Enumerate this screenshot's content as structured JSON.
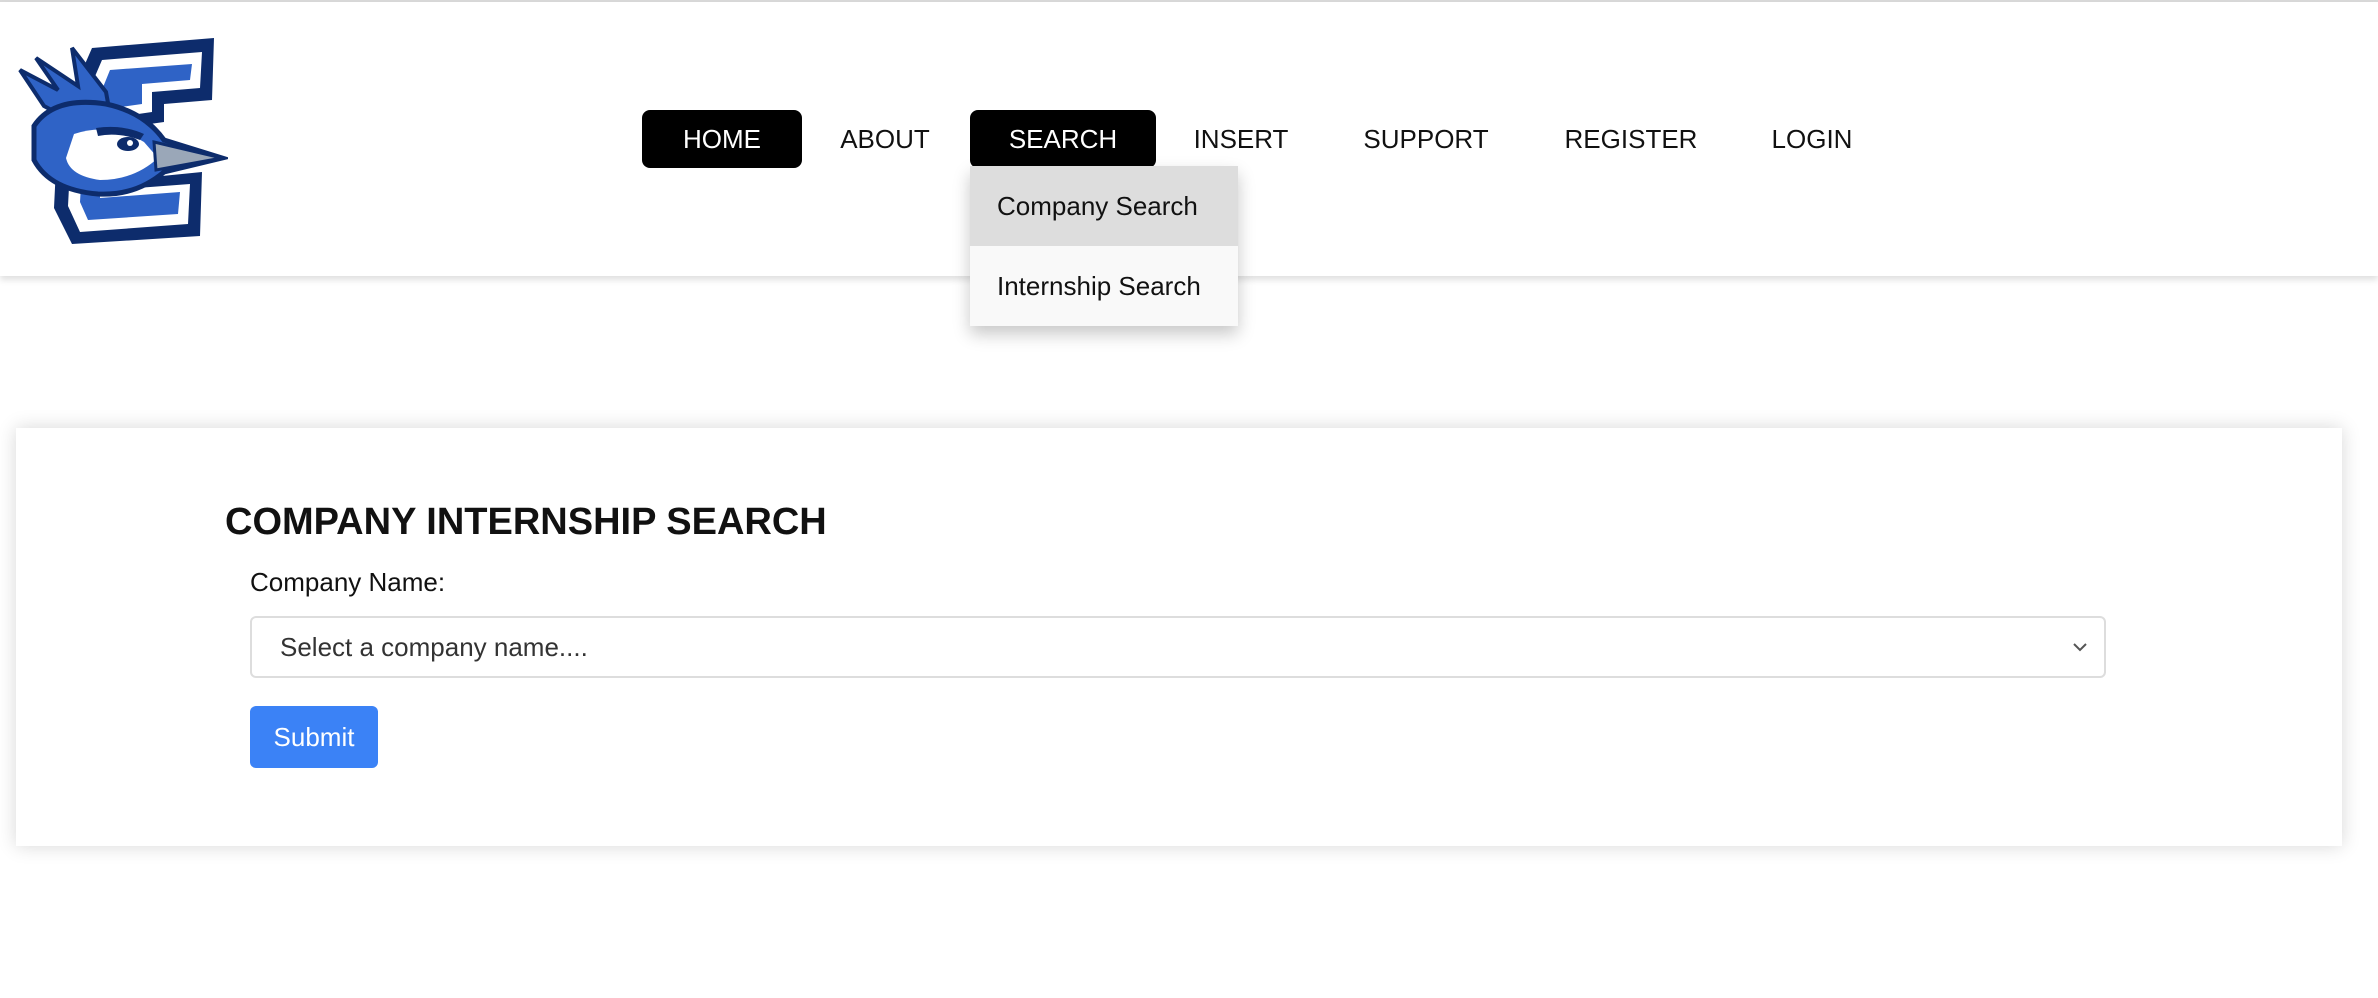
{
  "nav": {
    "items": [
      {
        "label": "HOME",
        "active": true
      },
      {
        "label": "ABOUT",
        "active": false
      },
      {
        "label": "SEARCH",
        "active": true
      },
      {
        "label": "INSERT",
        "active": false
      },
      {
        "label": "SUPPORT",
        "active": false
      },
      {
        "label": "REGISTER",
        "active": false
      },
      {
        "label": "LOGIN",
        "active": false
      }
    ],
    "search_dropdown": {
      "items": [
        {
          "label": "Company Search",
          "highlighted": true
        },
        {
          "label": "Internship Search",
          "highlighted": false
        }
      ]
    }
  },
  "logo": {
    "icon": "bluejay-c-logo-icon",
    "colors": {
      "navy": "#0d2c6c",
      "blue": "#2f63c6",
      "white": "#ffffff"
    }
  },
  "main": {
    "title": "COMPANY INTERNSHIP SEARCH",
    "company_label": "Company Name:",
    "select_placeholder": "Select a company name....",
    "submit_label": "Submit"
  },
  "colors": {
    "nav_active_bg": "#000000",
    "submit_bg": "#3b82f6",
    "dropdown_highlight": "#dddddd"
  }
}
